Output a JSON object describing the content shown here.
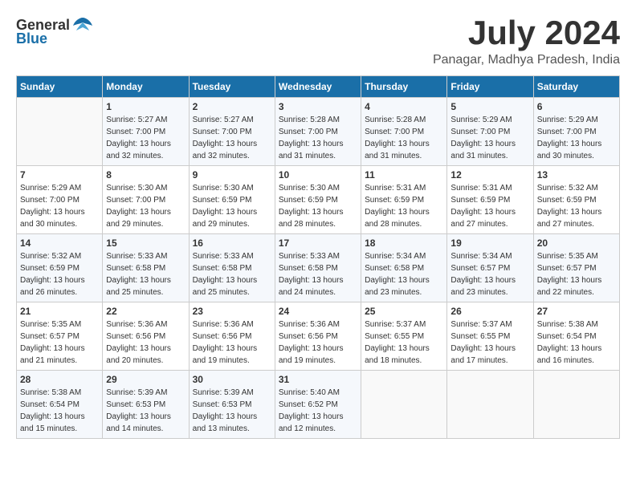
{
  "header": {
    "logo_general": "General",
    "logo_blue": "Blue",
    "month_title": "July 2024",
    "location": "Panagar, Madhya Pradesh, India"
  },
  "weekdays": [
    "Sunday",
    "Monday",
    "Tuesday",
    "Wednesday",
    "Thursday",
    "Friday",
    "Saturday"
  ],
  "weeks": [
    [
      {
        "day": "",
        "sunrise": "",
        "sunset": "",
        "daylight": ""
      },
      {
        "day": "1",
        "sunrise": "Sunrise: 5:27 AM",
        "sunset": "Sunset: 7:00 PM",
        "daylight": "Daylight: 13 hours and 32 minutes."
      },
      {
        "day": "2",
        "sunrise": "Sunrise: 5:27 AM",
        "sunset": "Sunset: 7:00 PM",
        "daylight": "Daylight: 13 hours and 32 minutes."
      },
      {
        "day": "3",
        "sunrise": "Sunrise: 5:28 AM",
        "sunset": "Sunset: 7:00 PM",
        "daylight": "Daylight: 13 hours and 31 minutes."
      },
      {
        "day": "4",
        "sunrise": "Sunrise: 5:28 AM",
        "sunset": "Sunset: 7:00 PM",
        "daylight": "Daylight: 13 hours and 31 minutes."
      },
      {
        "day": "5",
        "sunrise": "Sunrise: 5:29 AM",
        "sunset": "Sunset: 7:00 PM",
        "daylight": "Daylight: 13 hours and 31 minutes."
      },
      {
        "day": "6",
        "sunrise": "Sunrise: 5:29 AM",
        "sunset": "Sunset: 7:00 PM",
        "daylight": "Daylight: 13 hours and 30 minutes."
      }
    ],
    [
      {
        "day": "7",
        "sunrise": "Sunrise: 5:29 AM",
        "sunset": "Sunset: 7:00 PM",
        "daylight": "Daylight: 13 hours and 30 minutes."
      },
      {
        "day": "8",
        "sunrise": "Sunrise: 5:30 AM",
        "sunset": "Sunset: 7:00 PM",
        "daylight": "Daylight: 13 hours and 29 minutes."
      },
      {
        "day": "9",
        "sunrise": "Sunrise: 5:30 AM",
        "sunset": "Sunset: 6:59 PM",
        "daylight": "Daylight: 13 hours and 29 minutes."
      },
      {
        "day": "10",
        "sunrise": "Sunrise: 5:30 AM",
        "sunset": "Sunset: 6:59 PM",
        "daylight": "Daylight: 13 hours and 28 minutes."
      },
      {
        "day": "11",
        "sunrise": "Sunrise: 5:31 AM",
        "sunset": "Sunset: 6:59 PM",
        "daylight": "Daylight: 13 hours and 28 minutes."
      },
      {
        "day": "12",
        "sunrise": "Sunrise: 5:31 AM",
        "sunset": "Sunset: 6:59 PM",
        "daylight": "Daylight: 13 hours and 27 minutes."
      },
      {
        "day": "13",
        "sunrise": "Sunrise: 5:32 AM",
        "sunset": "Sunset: 6:59 PM",
        "daylight": "Daylight: 13 hours and 27 minutes."
      }
    ],
    [
      {
        "day": "14",
        "sunrise": "Sunrise: 5:32 AM",
        "sunset": "Sunset: 6:59 PM",
        "daylight": "Daylight: 13 hours and 26 minutes."
      },
      {
        "day": "15",
        "sunrise": "Sunrise: 5:33 AM",
        "sunset": "Sunset: 6:58 PM",
        "daylight": "Daylight: 13 hours and 25 minutes."
      },
      {
        "day": "16",
        "sunrise": "Sunrise: 5:33 AM",
        "sunset": "Sunset: 6:58 PM",
        "daylight": "Daylight: 13 hours and 25 minutes."
      },
      {
        "day": "17",
        "sunrise": "Sunrise: 5:33 AM",
        "sunset": "Sunset: 6:58 PM",
        "daylight": "Daylight: 13 hours and 24 minutes."
      },
      {
        "day": "18",
        "sunrise": "Sunrise: 5:34 AM",
        "sunset": "Sunset: 6:58 PM",
        "daylight": "Daylight: 13 hours and 23 minutes."
      },
      {
        "day": "19",
        "sunrise": "Sunrise: 5:34 AM",
        "sunset": "Sunset: 6:57 PM",
        "daylight": "Daylight: 13 hours and 23 minutes."
      },
      {
        "day": "20",
        "sunrise": "Sunrise: 5:35 AM",
        "sunset": "Sunset: 6:57 PM",
        "daylight": "Daylight: 13 hours and 22 minutes."
      }
    ],
    [
      {
        "day": "21",
        "sunrise": "Sunrise: 5:35 AM",
        "sunset": "Sunset: 6:57 PM",
        "daylight": "Daylight: 13 hours and 21 minutes."
      },
      {
        "day": "22",
        "sunrise": "Sunrise: 5:36 AM",
        "sunset": "Sunset: 6:56 PM",
        "daylight": "Daylight: 13 hours and 20 minutes."
      },
      {
        "day": "23",
        "sunrise": "Sunrise: 5:36 AM",
        "sunset": "Sunset: 6:56 PM",
        "daylight": "Daylight: 13 hours and 19 minutes."
      },
      {
        "day": "24",
        "sunrise": "Sunrise: 5:36 AM",
        "sunset": "Sunset: 6:56 PM",
        "daylight": "Daylight: 13 hours and 19 minutes."
      },
      {
        "day": "25",
        "sunrise": "Sunrise: 5:37 AM",
        "sunset": "Sunset: 6:55 PM",
        "daylight": "Daylight: 13 hours and 18 minutes."
      },
      {
        "day": "26",
        "sunrise": "Sunrise: 5:37 AM",
        "sunset": "Sunset: 6:55 PM",
        "daylight": "Daylight: 13 hours and 17 minutes."
      },
      {
        "day": "27",
        "sunrise": "Sunrise: 5:38 AM",
        "sunset": "Sunset: 6:54 PM",
        "daylight": "Daylight: 13 hours and 16 minutes."
      }
    ],
    [
      {
        "day": "28",
        "sunrise": "Sunrise: 5:38 AM",
        "sunset": "Sunset: 6:54 PM",
        "daylight": "Daylight: 13 hours and 15 minutes."
      },
      {
        "day": "29",
        "sunrise": "Sunrise: 5:39 AM",
        "sunset": "Sunset: 6:53 PM",
        "daylight": "Daylight: 13 hours and 14 minutes."
      },
      {
        "day": "30",
        "sunrise": "Sunrise: 5:39 AM",
        "sunset": "Sunset: 6:53 PM",
        "daylight": "Daylight: 13 hours and 13 minutes."
      },
      {
        "day": "31",
        "sunrise": "Sunrise: 5:40 AM",
        "sunset": "Sunset: 6:52 PM",
        "daylight": "Daylight: 13 hours and 12 minutes."
      },
      {
        "day": "",
        "sunrise": "",
        "sunset": "",
        "daylight": ""
      },
      {
        "day": "",
        "sunrise": "",
        "sunset": "",
        "daylight": ""
      },
      {
        "day": "",
        "sunrise": "",
        "sunset": "",
        "daylight": ""
      }
    ]
  ]
}
